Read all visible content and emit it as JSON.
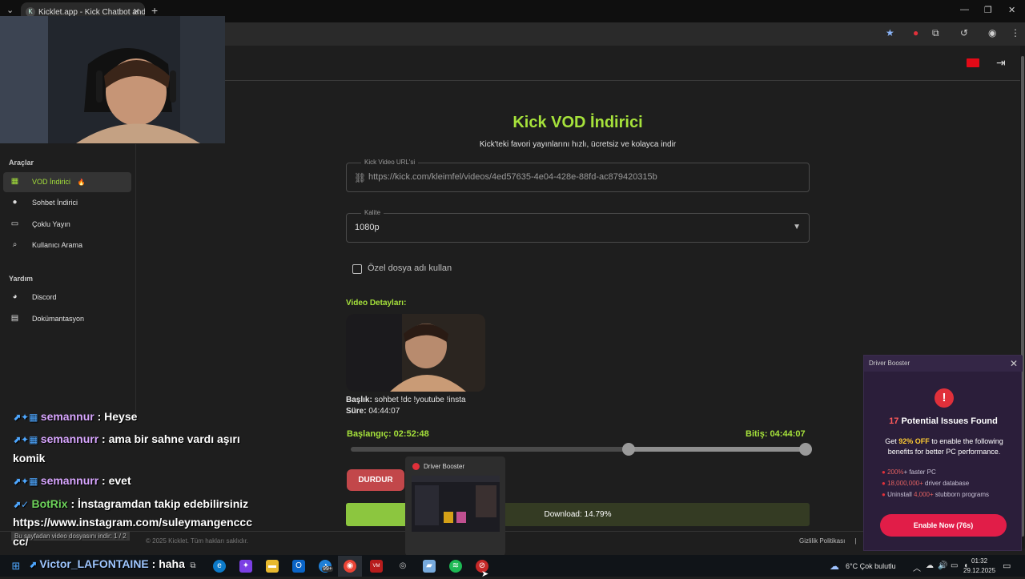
{
  "browser": {
    "tab_title": "Kicklet.app - Kick Chatbot and C",
    "tab_close": "✕",
    "new_tab": "+"
  },
  "sidebar": {
    "section_tools": "Araçlar",
    "items": [
      {
        "label": "VOD İndirici",
        "badge": "🔥"
      },
      {
        "label": "Sohbet İndirici"
      },
      {
        "label": "Çoklu Yayın"
      },
      {
        "label": "Kullanıcı Arama"
      }
    ],
    "section_help": "Yardım",
    "help_items": [
      {
        "label": "Discord"
      },
      {
        "label": "Dokümantasyon"
      }
    ]
  },
  "main": {
    "title": "Kick VOD İndirici",
    "subtitle": "Kick'teki favori yayınlarını hızlı, ücretsiz ve kolayca indir",
    "url_field": {
      "label": "Kick Video URL'si",
      "value": "https://kick.com/kleimfel/videos/4ed57635-4e04-428e-88fd-ac879420315b"
    },
    "quality_field": {
      "label": "Kalite",
      "value": "1080p"
    },
    "custom_name_label": "Özel dosya adı kullan",
    "details_title": "Video Detayları:",
    "meta_title_label": "Başlık:",
    "meta_title_value": " sohbet !dc !youtube !insta",
    "meta_duration_label": "Süre:",
    "meta_duration_value": " 04:44:07",
    "start_label": "Başlangıç: 02:52:48",
    "end_label": "Bitiş: 04:44:07",
    "range_start_fraction": 0.6087,
    "range_end_fraction": 1.0,
    "stop_button": "DURDUR",
    "progress_text": "Download: 14.79%",
    "progress_fraction": 0.1479
  },
  "footer": {
    "copyright": "© 2025 Kicklet. Tüm hakları saklıdır.",
    "privacy": "Gizlilik Politikası",
    "separator": "|"
  },
  "chat": {
    "line0_user": "semannur",
    "line0_text": " : Heyse",
    "line1_user": "semannurr",
    "line1_text": " : ama bir sahne vardı aşırı",
    "line1b": "komik",
    "line2_user": "semannurr",
    "line2_text": " : evet",
    "line3_user": "BotRix",
    "line3_text": " : İnstagramdan takip edebilirsiniz",
    "line3b": "https://www.instagram.com/suleymangenccc",
    "line3c": "cc/",
    "hint": "Bu sayfadan video dosyasını indir: 1 / 2",
    "victor_user": "Victor_LAFONTAINE",
    "victor_text": " : haha"
  },
  "popup": {
    "header": "Driver Booster",
    "issues_count": "17",
    "issues_text": " Potential Issues Found",
    "offer_prefix": "Get ",
    "offer_highlight": "92% OFF",
    "offer_suffix": " to enable the following benefits for better PC performance.",
    "bullet1_hl": "200%",
    "bullet1": "+ faster PC",
    "bullet2_hl": "18,000,000+",
    "bullet2": " driver database",
    "bullet3_pre": "Uninstall ",
    "bullet3_hl": "4,000+",
    "bullet3": " stubborn programs",
    "button": "Enable Now (76s)"
  },
  "task_thumb": {
    "title": "Driver Booster"
  },
  "taskbar": {
    "weather": "6°C  Çok bulutlu",
    "time": "01:32",
    "date": "29.12.2025",
    "badge": "99+"
  },
  "colors": {
    "accent": "#a6e23b",
    "stop": "#c2474a",
    "popup_button": "#e11d48"
  }
}
